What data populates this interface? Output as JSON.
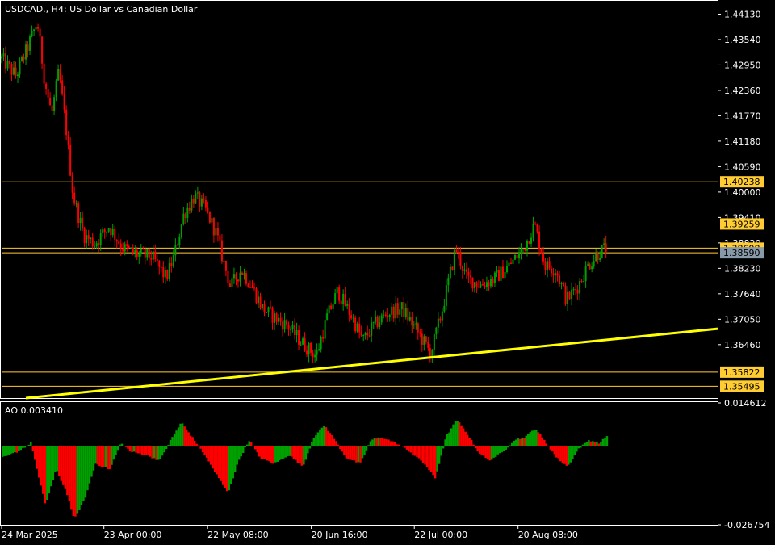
{
  "chart_data": [
    {
      "type": "candlestick",
      "title": "USDCAD., H4:  US Dollar vs Canadian Dollar",
      "symbol": "USDCAD.",
      "timeframe": "H4",
      "description": "US Dollar vs Canadian Dollar",
      "ylim": [
        1.3522,
        1.4442
      ],
      "y_ticks": [
        "1.44130",
        "1.43540",
        "1.42950",
        "1.42360",
        "1.41770",
        "1.41180",
        "1.40590",
        "1.40000",
        "1.39410",
        "1.38820",
        "1.38230",
        "1.37640",
        "1.37050",
        "1.36460"
      ],
      "x_ticks": [
        "24 Mar 2025",
        "23 Apr 00:00",
        "22 May 08:00",
        "20 Jun 16:00",
        "22 Jul 00:00",
        "20 Aug 08:00"
      ],
      "horizontal_levels": [
        {
          "value": 1.40238,
          "label": "1.40238"
        },
        {
          "value": 1.39259,
          "label": "1.39259"
        },
        {
          "value": 1.38698,
          "label": "1.38698"
        },
        {
          "value": 1.3859,
          "label": "1.38590"
        },
        {
          "value": 1.35822,
          "label": "1.35822"
        },
        {
          "value": 1.35495,
          "label": "1.35495"
        }
      ],
      "trendline": {
        "from": {
          "x": "24 Mar 2025",
          "y": 1.3522
        },
        "to": {
          "x": "right edge",
          "y": 1.3683
        },
        "color": "#ffff00"
      },
      "close_path": [
        [
          0.0,
          1.431
        ],
        [
          0.02,
          1.427
        ],
        [
          0.035,
          1.433
        ],
        [
          0.05,
          1.4395
        ],
        [
          0.06,
          1.426
        ],
        [
          0.07,
          1.418
        ],
        [
          0.08,
          1.428
        ],
        [
          0.09,
          1.415
        ],
        [
          0.1,
          1.399
        ],
        [
          0.115,
          1.39
        ],
        [
          0.13,
          1.388
        ],
        [
          0.15,
          1.392
        ],
        [
          0.17,
          1.387
        ],
        [
          0.19,
          1.3855
        ],
        [
          0.21,
          1.385
        ],
        [
          0.23,
          1.38
        ],
        [
          0.24,
          1.3845
        ],
        [
          0.255,
          1.395
        ],
        [
          0.27,
          1.399
        ],
        [
          0.285,
          1.396
        ],
        [
          0.3,
          1.3905
        ],
        [
          0.31,
          1.384
        ],
        [
          0.32,
          1.378
        ],
        [
          0.335,
          1.382
        ],
        [
          0.35,
          1.378
        ],
        [
          0.365,
          1.373
        ],
        [
          0.38,
          1.371
        ],
        [
          0.4,
          1.369
        ],
        [
          0.42,
          1.365
        ],
        [
          0.44,
          1.362
        ],
        [
          0.455,
          1.371
        ],
        [
          0.47,
          1.377
        ],
        [
          0.49,
          1.371
        ],
        [
          0.505,
          1.3655
        ],
        [
          0.52,
          1.369
        ],
        [
          0.54,
          1.372
        ],
        [
          0.56,
          1.373
        ],
        [
          0.58,
          1.368
        ],
        [
          0.6,
          1.3625
        ],
        [
          0.615,
          1.372
        ],
        [
          0.635,
          1.387
        ],
        [
          0.65,
          1.38
        ],
        [
          0.67,
          1.3785
        ],
        [
          0.69,
          1.38
        ],
        [
          0.71,
          1.383
        ],
        [
          0.73,
          1.387
        ],
        [
          0.745,
          1.3925
        ],
        [
          0.76,
          1.383
        ],
        [
          0.775,
          1.382
        ],
        [
          0.79,
          1.375
        ],
        [
          0.805,
          1.378
        ],
        [
          0.82,
          1.383
        ],
        [
          0.835,
          1.386
        ],
        [
          0.845,
          1.387
        ]
      ],
      "bull_color": "#00a000",
      "bear_color": "#ff0000"
    },
    {
      "type": "bar",
      "title": "AO 0.003410",
      "indicator": "Awesome Oscillator",
      "value_label": "0.003410",
      "ylim": [
        -0.026754,
        0.014612
      ],
      "y_ticks": [
        "0.014612",
        "-0.026754"
      ],
      "profile": [
        [
          0.0,
          -0.004
        ],
        [
          0.02,
          -0.002
        ],
        [
          0.04,
          0.001
        ],
        [
          0.05,
          -0.01
        ],
        [
          0.06,
          -0.02
        ],
        [
          0.075,
          -0.008
        ],
        [
          0.09,
          -0.016
        ],
        [
          0.1,
          -0.025
        ],
        [
          0.115,
          -0.018
        ],
        [
          0.13,
          -0.006
        ],
        [
          0.15,
          -0.008
        ],
        [
          0.165,
          0.001
        ],
        [
          0.18,
          -0.002
        ],
        [
          0.2,
          -0.003
        ],
        [
          0.22,
          -0.005
        ],
        [
          0.235,
          0.002
        ],
        [
          0.25,
          0.008
        ],
        [
          0.265,
          0.003
        ],
        [
          0.28,
          -0.002
        ],
        [
          0.3,
          -0.01
        ],
        [
          0.315,
          -0.016
        ],
        [
          0.33,
          -0.005
        ],
        [
          0.345,
          0.002
        ],
        [
          0.36,
          -0.004
        ],
        [
          0.38,
          -0.006
        ],
        [
          0.4,
          -0.003
        ],
        [
          0.42,
          -0.007
        ],
        [
          0.435,
          0.003
        ],
        [
          0.45,
          0.007
        ],
        [
          0.465,
          0.002
        ],
        [
          0.48,
          -0.004
        ],
        [
          0.5,
          -0.006
        ],
        [
          0.515,
          0.002
        ],
        [
          0.53,
          0.003
        ],
        [
          0.55,
          0.001
        ],
        [
          0.57,
          -0.002
        ],
        [
          0.59,
          -0.006
        ],
        [
          0.605,
          -0.011
        ],
        [
          0.62,
          0.003
        ],
        [
          0.635,
          0.009
        ],
        [
          0.65,
          0.004
        ],
        [
          0.665,
          -0.002
        ],
        [
          0.68,
          -0.005
        ],
        [
          0.7,
          -0.002
        ],
        [
          0.715,
          0.002
        ],
        [
          0.73,
          0.003
        ],
        [
          0.745,
          0.006
        ],
        [
          0.76,
          0.001
        ],
        [
          0.775,
          -0.004
        ],
        [
          0.79,
          -0.007
        ],
        [
          0.805,
          -0.001
        ],
        [
          0.82,
          0.002
        ],
        [
          0.835,
          0.001
        ],
        [
          0.845,
          0.0034
        ]
      ],
      "up_color": "#00a000",
      "down_color": "#ff0000"
    }
  ],
  "colors": {
    "background": "#000000",
    "grid_border": "#ffffff",
    "level_line": "#ffcc33",
    "level_label_bg": "#ffcc33",
    "trendline": "#ffff00",
    "current_price_bg": "#8899aa"
  }
}
